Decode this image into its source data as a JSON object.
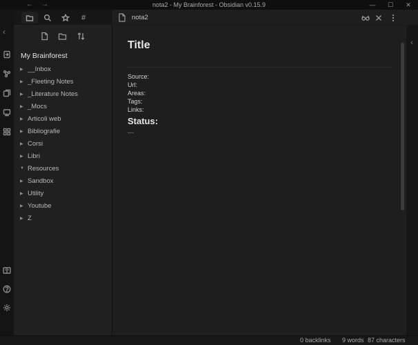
{
  "window": {
    "title": "nota2 - My Brainforest - Obsidian v0.15.9",
    "back": "←",
    "forward": "→",
    "minimize": "—",
    "maximize": "☐",
    "close": "✕"
  },
  "sidebar": {
    "vault_name": "My Brainforest",
    "tabs": [
      {
        "name": "file-explorer",
        "active": true
      },
      {
        "name": "search",
        "active": false
      },
      {
        "name": "starred",
        "active": false
      },
      {
        "name": "tags",
        "active": false
      }
    ],
    "tags_symbol": "#",
    "tree": [
      {
        "label": "__Inbox",
        "expanded": false
      },
      {
        "label": "_Fleeting Notes",
        "expanded": false
      },
      {
        "label": "_Literature Notes",
        "expanded": false
      },
      {
        "label": "_Mocs",
        "expanded": false
      },
      {
        "label": "Articoli web",
        "expanded": false
      },
      {
        "label": "Bibliografie",
        "expanded": false
      },
      {
        "label": "Corsi",
        "expanded": false
      },
      {
        "label": "Libri",
        "expanded": false
      },
      {
        "label": "Resources",
        "expanded": true
      },
      {
        "label": "Sandbox",
        "expanded": false
      },
      {
        "label": "Utility",
        "expanded": false
      },
      {
        "label": "Youtube",
        "expanded": false
      },
      {
        "label": "Z",
        "expanded": false
      }
    ]
  },
  "view": {
    "tab_title": "nota2",
    "left_collapse": "‹",
    "right_collapse": "‹"
  },
  "document": {
    "title": "Title",
    "fields": [
      "Source:",
      "Url:",
      "Areas:",
      "Tags:",
      "Links:"
    ],
    "status_heading": "Status:",
    "separator": "---"
  },
  "statusbar": {
    "backlinks": "0 backlinks",
    "words": "9 words",
    "characters": "87 characters"
  },
  "colors": {
    "background": "#1e1e1e",
    "sidebar": "#202020",
    "ribbon": "#141414",
    "text": "#dcddde"
  }
}
